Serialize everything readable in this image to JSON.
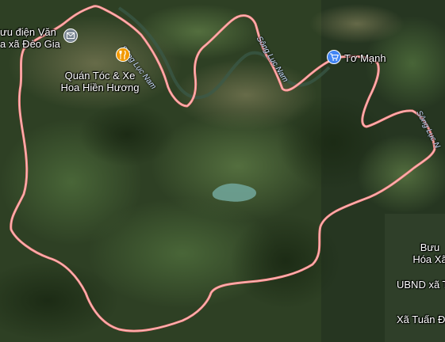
{
  "places": {
    "post_office_left": {
      "line1": "ưu điện Văn",
      "line2": "a xã Đèo Gia"
    },
    "barber": {
      "line1": "Quán Tóc & Xe",
      "line2": "Hoa Hiền Hương"
    },
    "shop": {
      "name": "Tơ Mạnh"
    },
    "post_office_right": {
      "line1": "Bưu",
      "line2": "Hóa Xã"
    },
    "ubnd": {
      "name": "UBND xã T"
    },
    "xa_tuan": {
      "name": "Xã Tuấn Đ"
    }
  },
  "rivers": [
    {
      "label": "Sông Lục Nam"
    },
    {
      "label": "Sông Lục Nam"
    },
    {
      "label": "Sông Lục N"
    }
  ],
  "colors": {
    "boundary": "#ff9a9a",
    "shop_pin": "#4285f4",
    "food_pin": "#f29900",
    "post_pin": "#7b8794"
  },
  "icons": {
    "post": "envelope-icon",
    "food": "fork-knife-icon",
    "shop": "shopping-cart-icon"
  }
}
